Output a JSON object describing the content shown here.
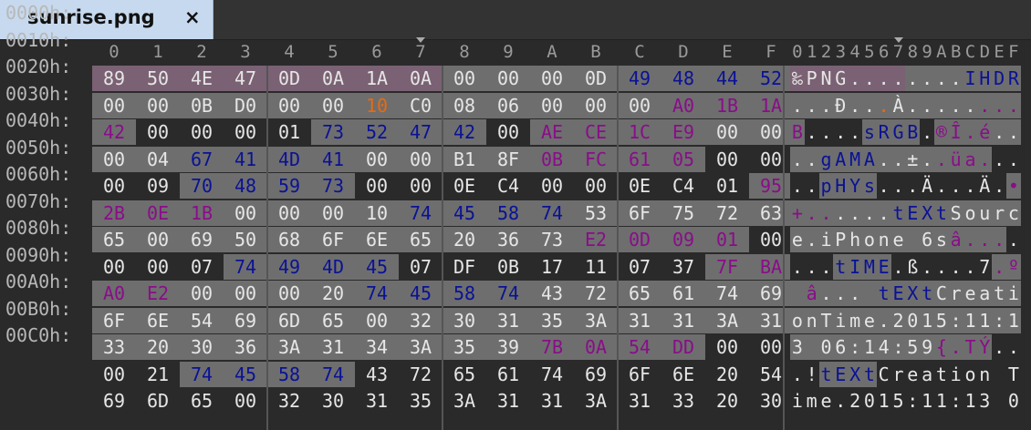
{
  "tab": {
    "title": "sunrise.png",
    "close_label": "×"
  },
  "colors": {
    "background": "#2a2a2a",
    "cell_gray": "#6e6e6e",
    "cell_dark": "#2a2a2a",
    "header_pink": "#7a6173",
    "text_default": "#e6e6e6",
    "text_navy": "#0a1296",
    "text_purple": "#8a0d8a",
    "text_orange": "#e86a10"
  },
  "hex_header": [
    "0",
    "1",
    "2",
    "3",
    "4",
    "5",
    "6",
    "7",
    "8",
    "9",
    "A",
    "B",
    "C",
    "D",
    "E",
    "F"
  ],
  "ascii_header": "0123456789ABCDEF",
  "markers": {
    "hex_column": 7,
    "ascii_column": 7
  },
  "offsets": [
    "0000h:",
    "0010h:",
    "0020h:",
    "0030h:",
    "0040h:",
    "0050h:",
    "0060h:",
    "0070h:",
    "0080h:",
    "0090h:",
    "00A0h:",
    "00B0h:",
    "00C0h:"
  ],
  "rows": [
    {
      "bytes": [
        "89",
        "50",
        "4E",
        "47",
        "0D",
        "0A",
        "1A",
        "0A",
        "00",
        "00",
        "00",
        "0D",
        "49",
        "48",
        "44",
        "52"
      ],
      "colors": [
        "d",
        "d",
        "d",
        "d",
        "d",
        "d",
        "d",
        "d",
        "d",
        "d",
        "d",
        "d",
        "n",
        "n",
        "n",
        "n"
      ],
      "bg": [
        "p",
        "p",
        "p",
        "p",
        "p",
        "p",
        "p",
        "p",
        "g",
        "g",
        "g",
        "g",
        "g",
        "g",
        "g",
        "g"
      ],
      "ascii": [
        "‰",
        "P",
        "N",
        "G",
        ".",
        ".",
        ".",
        ".",
        ".",
        ".",
        ".",
        ".",
        "I",
        "H",
        "D",
        "R"
      ]
    },
    {
      "bytes": [
        "00",
        "00",
        "0B",
        "D0",
        "00",
        "00",
        "10",
        "C0",
        "08",
        "06",
        "00",
        "00",
        "00",
        "A0",
        "1B",
        "1A"
      ],
      "colors": [
        "d",
        "d",
        "d",
        "d",
        "d",
        "d",
        "o",
        "d",
        "d",
        "d",
        "d",
        "d",
        "d",
        "u",
        "u",
        "u"
      ],
      "bg": [
        "g",
        "g",
        "g",
        "g",
        "g",
        "g",
        "g",
        "g",
        "g",
        "g",
        "g",
        "g",
        "g",
        "g",
        "g",
        "g"
      ],
      "ascii": [
        ".",
        ".",
        ".",
        "Ð",
        ".",
        ".",
        ".",
        "À",
        ".",
        ".",
        ".",
        ".",
        ".",
        ".",
        ".",
        "."
      ]
    },
    {
      "bytes": [
        "42",
        "00",
        "00",
        "00",
        "01",
        "73",
        "52",
        "47",
        "42",
        "00",
        "AE",
        "CE",
        "1C",
        "E9",
        "00",
        "00"
      ],
      "colors": [
        "u",
        "d",
        "d",
        "d",
        "d",
        "n",
        "n",
        "n",
        "n",
        "d",
        "u",
        "u",
        "u",
        "u",
        "d",
        "d"
      ],
      "bg": [
        "g",
        "k",
        "k",
        "k",
        "k",
        "g",
        "g",
        "g",
        "g",
        "k",
        "g",
        "g",
        "g",
        "g",
        "g",
        "g"
      ],
      "ascii": [
        "B",
        ".",
        ".",
        ".",
        ".",
        "s",
        "R",
        "G",
        "B",
        ".",
        "®",
        "Î",
        ".",
        "é",
        ".",
        "."
      ]
    },
    {
      "bytes": [
        "00",
        "04",
        "67",
        "41",
        "4D",
        "41",
        "00",
        "00",
        "B1",
        "8F",
        "0B",
        "FC",
        "61",
        "05",
        "00",
        "00"
      ],
      "colors": [
        "d",
        "d",
        "n",
        "n",
        "n",
        "n",
        "d",
        "d",
        "d",
        "d",
        "u",
        "u",
        "u",
        "u",
        "d",
        "d"
      ],
      "bg": [
        "g",
        "g",
        "g",
        "g",
        "g",
        "g",
        "g",
        "g",
        "g",
        "g",
        "g",
        "g",
        "g",
        "g",
        "k",
        "k"
      ],
      "ascii": [
        ".",
        ".",
        "g",
        "A",
        "M",
        "A",
        ".",
        ".",
        "±",
        ".",
        ".",
        "ü",
        "a",
        ".",
        ".",
        "."
      ]
    },
    {
      "bytes": [
        "00",
        "09",
        "70",
        "48",
        "59",
        "73",
        "00",
        "00",
        "0E",
        "C4",
        "00",
        "00",
        "0E",
        "C4",
        "01",
        "95"
      ],
      "colors": [
        "d",
        "d",
        "n",
        "n",
        "n",
        "n",
        "d",
        "d",
        "d",
        "d",
        "d",
        "d",
        "d",
        "d",
        "d",
        "u"
      ],
      "bg": [
        "k",
        "k",
        "g",
        "g",
        "g",
        "g",
        "k",
        "k",
        "k",
        "k",
        "k",
        "k",
        "k",
        "k",
        "k",
        "g"
      ],
      "ascii": [
        ".",
        ".",
        "p",
        "H",
        "Y",
        "s",
        ".",
        ".",
        ".",
        "Ä",
        ".",
        ".",
        ".",
        "Ä",
        ".",
        "•"
      ]
    },
    {
      "bytes": [
        "2B",
        "0E",
        "1B",
        "00",
        "00",
        "00",
        "10",
        "74",
        "45",
        "58",
        "74",
        "53",
        "6F",
        "75",
        "72",
        "63"
      ],
      "colors": [
        "u",
        "u",
        "u",
        "d",
        "d",
        "d",
        "d",
        "n",
        "n",
        "n",
        "n",
        "d",
        "d",
        "d",
        "d",
        "d"
      ],
      "bg": [
        "g",
        "g",
        "g",
        "g",
        "g",
        "g",
        "g",
        "g",
        "g",
        "g",
        "g",
        "g",
        "g",
        "g",
        "g",
        "g"
      ],
      "ascii": [
        "+",
        ".",
        ".",
        ".",
        ".",
        ".",
        ".",
        "t",
        "E",
        "X",
        "t",
        "S",
        "o",
        "u",
        "r",
        "c"
      ]
    },
    {
      "bytes": [
        "65",
        "00",
        "69",
        "50",
        "68",
        "6F",
        "6E",
        "65",
        "20",
        "36",
        "73",
        "E2",
        "0D",
        "09",
        "01",
        "00"
      ],
      "colors": [
        "d",
        "d",
        "d",
        "d",
        "d",
        "d",
        "d",
        "d",
        "d",
        "d",
        "d",
        "u",
        "u",
        "u",
        "u",
        "d"
      ],
      "bg": [
        "g",
        "g",
        "g",
        "g",
        "g",
        "g",
        "g",
        "g",
        "g",
        "g",
        "g",
        "g",
        "g",
        "g",
        "g",
        "k"
      ],
      "ascii": [
        "e",
        ".",
        "i",
        "P",
        "h",
        "o",
        "n",
        "e",
        " ",
        "6",
        "s",
        "â",
        ".",
        ".",
        ".",
        "."
      ]
    },
    {
      "bytes": [
        "00",
        "00",
        "07",
        "74",
        "49",
        "4D",
        "45",
        "07",
        "DF",
        "0B",
        "17",
        "11",
        "07",
        "37",
        "7F",
        "BA"
      ],
      "colors": [
        "d",
        "d",
        "d",
        "n",
        "n",
        "n",
        "n",
        "d",
        "d",
        "d",
        "d",
        "d",
        "d",
        "d",
        "u",
        "u"
      ],
      "bg": [
        "k",
        "k",
        "k",
        "g",
        "g",
        "g",
        "g",
        "k",
        "k",
        "k",
        "k",
        "k",
        "k",
        "k",
        "g",
        "g"
      ],
      "ascii": [
        ".",
        ".",
        ".",
        "t",
        "I",
        "M",
        "E",
        ".",
        "ß",
        ".",
        ".",
        ".",
        ".",
        "7",
        ".",
        "º"
      ]
    },
    {
      "bytes": [
        "A0",
        "E2",
        "00",
        "00",
        "00",
        "20",
        "74",
        "45",
        "58",
        "74",
        "43",
        "72",
        "65",
        "61",
        "74",
        "69"
      ],
      "colors": [
        "u",
        "u",
        "d",
        "d",
        "d",
        "d",
        "n",
        "n",
        "n",
        "n",
        "d",
        "d",
        "d",
        "d",
        "d",
        "d"
      ],
      "bg": [
        "g",
        "g",
        "g",
        "g",
        "g",
        "g",
        "g",
        "g",
        "g",
        "g",
        "g",
        "g",
        "g",
        "g",
        "g",
        "g"
      ],
      "ascii": [
        " ",
        "â",
        ".",
        ".",
        ".",
        " ",
        "t",
        "E",
        "X",
        "t",
        "C",
        "r",
        "e",
        "a",
        "t",
        "i"
      ]
    },
    {
      "bytes": [
        "6F",
        "6E",
        "54",
        "69",
        "6D",
        "65",
        "00",
        "32",
        "30",
        "31",
        "35",
        "3A",
        "31",
        "31",
        "3A",
        "31"
      ],
      "colors": [
        "d",
        "d",
        "d",
        "d",
        "d",
        "d",
        "d",
        "d",
        "d",
        "d",
        "d",
        "d",
        "d",
        "d",
        "d",
        "d"
      ],
      "bg": [
        "g",
        "g",
        "g",
        "g",
        "g",
        "g",
        "g",
        "g",
        "g",
        "g",
        "g",
        "g",
        "g",
        "g",
        "g",
        "g"
      ],
      "ascii": [
        "o",
        "n",
        "T",
        "i",
        "m",
        "e",
        ".",
        "2",
        "0",
        "1",
        "5",
        ":",
        "1",
        "1",
        ":",
        "1"
      ]
    },
    {
      "bytes": [
        "33",
        "20",
        "30",
        "36",
        "3A",
        "31",
        "34",
        "3A",
        "35",
        "39",
        "7B",
        "0A",
        "54",
        "DD",
        "00",
        "00"
      ],
      "colors": [
        "d",
        "d",
        "d",
        "d",
        "d",
        "d",
        "d",
        "d",
        "d",
        "d",
        "u",
        "u",
        "u",
        "u",
        "d",
        "d"
      ],
      "bg": [
        "g",
        "g",
        "g",
        "g",
        "g",
        "g",
        "g",
        "g",
        "g",
        "g",
        "g",
        "g",
        "g",
        "g",
        "k",
        "k"
      ],
      "ascii": [
        "3",
        " ",
        "0",
        "6",
        ":",
        "1",
        "4",
        ":",
        "5",
        "9",
        "{",
        ".",
        "T",
        "Ý",
        ".",
        "."
      ]
    },
    {
      "bytes": [
        "00",
        "21",
        "74",
        "45",
        "58",
        "74",
        "43",
        "72",
        "65",
        "61",
        "74",
        "69",
        "6F",
        "6E",
        "20",
        "54"
      ],
      "colors": [
        "d",
        "d",
        "n",
        "n",
        "n",
        "n",
        "d",
        "d",
        "d",
        "d",
        "d",
        "d",
        "d",
        "d",
        "d",
        "d"
      ],
      "bg": [
        "k",
        "k",
        "g",
        "g",
        "g",
        "g",
        "k",
        "k",
        "k",
        "k",
        "k",
        "k",
        "k",
        "k",
        "k",
        "k"
      ],
      "ascii": [
        ".",
        "!",
        "t",
        "E",
        "X",
        "t",
        "C",
        "r",
        "e",
        "a",
        "t",
        "i",
        "o",
        "n",
        " ",
        "T"
      ]
    },
    {
      "bytes": [
        "69",
        "6D",
        "65",
        "00",
        "32",
        "30",
        "31",
        "35",
        "3A",
        "31",
        "31",
        "3A",
        "31",
        "33",
        "20",
        "30"
      ],
      "colors": [
        "d",
        "d",
        "d",
        "d",
        "d",
        "d",
        "d",
        "d",
        "d",
        "d",
        "d",
        "d",
        "d",
        "d",
        "d",
        "d"
      ],
      "bg": [
        "k",
        "k",
        "k",
        "k",
        "k",
        "k",
        "k",
        "k",
        "k",
        "k",
        "k",
        "k",
        "k",
        "k",
        "k",
        "k"
      ],
      "ascii": [
        "i",
        "m",
        "e",
        ".",
        "2",
        "0",
        "1",
        "5",
        ":",
        "1",
        "1",
        ":",
        "1",
        "3",
        " ",
        "0"
      ]
    }
  ]
}
